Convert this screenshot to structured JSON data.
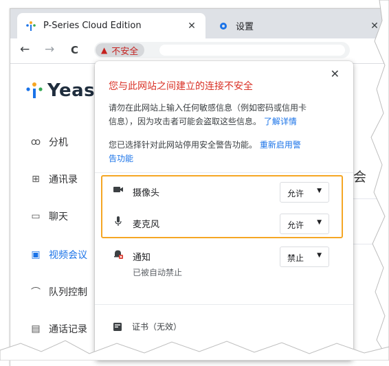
{
  "tabs": [
    {
      "title": "P-Series Cloud Edition",
      "active": true
    },
    {
      "title": "设置",
      "active": false
    }
  ],
  "toolbar": {
    "back": "←",
    "forward": "→",
    "reload": "C",
    "security_chip": "不安全",
    "warn_glyph": "▲"
  },
  "page": {
    "logo_text": "Yeast",
    "sidebar": [
      {
        "label": "分机",
        "icon": "user-list-icon",
        "glyph": "ꝏ"
      },
      {
        "label": "通讯录",
        "icon": "contacts-icon",
        "glyph": "⊞"
      },
      {
        "label": "聊天",
        "icon": "chat-icon",
        "glyph": "▭"
      },
      {
        "label": "视频会议",
        "icon": "video-conference-icon",
        "glyph": "▣",
        "active": true
      },
      {
        "label": "队列控制",
        "icon": "headset-icon",
        "glyph": "⌒"
      },
      {
        "label": "通话记录",
        "icon": "call-log-icon",
        "glyph": "▤"
      }
    ],
    "heading_fragment": "时会"
  },
  "popup": {
    "close_glyph": "✕",
    "title": "您与此网站之间建立的连接不安全",
    "warning_line1": "请勿在此网站上输入任何敏感信息（例如密码或信用卡",
    "warning_line2": "信息），因为攻击者可能会盗取这些信息。",
    "learn_more": "了解详情",
    "disabled_line1": "您已选择针对此网站停用安全警告功能。",
    "reenable_line1": "重新启用警",
    "reenable_line2": "告功能",
    "permissions": [
      {
        "label": "摄像头",
        "icon": "camera-icon",
        "value": "允许"
      },
      {
        "label": "麦克风",
        "icon": "microphone-icon",
        "value": "允许"
      },
      {
        "label": "通知",
        "icon": "notification-blocked-icon",
        "value": "禁止",
        "sub": "已被自动禁止"
      }
    ],
    "certificate": "证书（无效）"
  },
  "colors": {
    "accent": "#1a73e8",
    "danger": "#d93025",
    "highlight": "#f5a623"
  }
}
